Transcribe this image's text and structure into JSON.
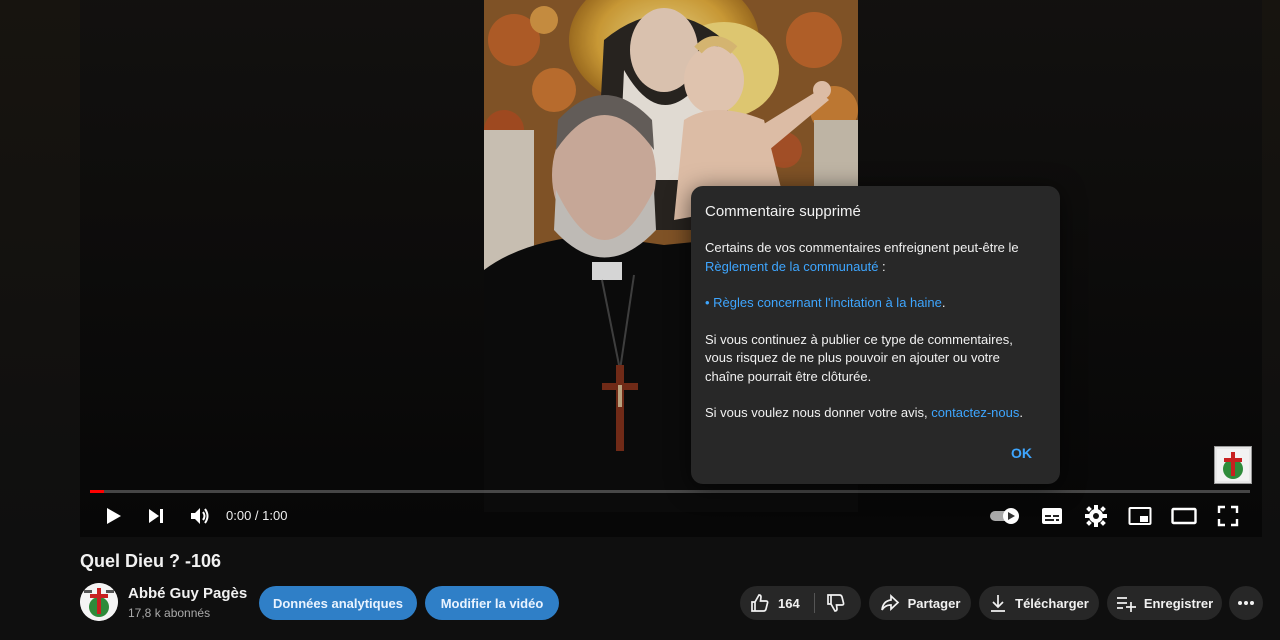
{
  "player": {
    "time_display": "0:00 / 1:00",
    "progress_fraction": 0.012
  },
  "dialog": {
    "title": "Commentaire supprimé",
    "intro": "Certains de vos commentaires enfreignent peut-être le",
    "community_link": "Règlement de la communauté",
    "community_suffix": " :",
    "policy_link": "• Règles concernant l'incitation à la haine",
    "policy_suffix": ".",
    "warning": "Si vous continuez à publier ce type de commentaires, vous risquez de ne plus pouvoir en ajouter ou votre chaîne pourrait être clôturée.",
    "feedback_text": "Si vous voulez nous donner votre avis, ",
    "feedback_link": "contactez-nous",
    "feedback_suffix": ".",
    "ok_label": "OK"
  },
  "video": {
    "title": "Quel Dieu ? -106"
  },
  "channel": {
    "name": "Abbé Guy Pagès",
    "subscribers": "17,8 k abonnés"
  },
  "actions": {
    "analytics_label": "Données analytiques",
    "edit_label": "Modifier la vidéo",
    "like_count": "164",
    "share_label": "Partager",
    "download_label": "Télécharger",
    "save_label": "Enregistrer"
  },
  "colors": {
    "accent_blue": "#3ea6ff",
    "progress_red": "#ff0000",
    "dialog_bg": "#282828"
  },
  "icons": [
    "play-icon",
    "next-icon",
    "volume-icon",
    "autoplay-toggle-icon",
    "subtitles-icon",
    "settings-gear-icon",
    "miniplayer-icon",
    "theater-mode-icon",
    "fullscreen-icon",
    "thumbs-up-icon",
    "thumbs-down-icon",
    "share-arrow-icon",
    "download-icon",
    "playlist-add-icon",
    "more-horizontal-icon"
  ]
}
